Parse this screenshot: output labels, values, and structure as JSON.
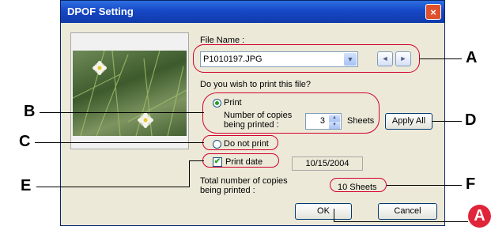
{
  "window": {
    "title": "DPOF Setting",
    "close_glyph": "×"
  },
  "labels": {
    "file_name": "File Name :",
    "question": "Do you wish to print this file?",
    "print": "Print",
    "copies_line1": "Number of copies",
    "copies_line2": "being printed :",
    "sheets": "Sheets",
    "do_not_print": "Do not print",
    "print_date": "Print date",
    "total_line1": "Total number of copies",
    "total_line2": "being printed :"
  },
  "file": {
    "name": "P1010197.JPG"
  },
  "copies": {
    "value": "3"
  },
  "date": {
    "value": "10/15/2004"
  },
  "total": {
    "value": "10  Sheets"
  },
  "buttons": {
    "apply_all": "Apply All",
    "ok": "OK",
    "cancel": "Cancel"
  },
  "icons": {
    "dropdown": "▼",
    "prev": "◄",
    "next": "►",
    "up": "▲",
    "down": "▼",
    "check": "✔"
  },
  "callouts": {
    "A": "A",
    "B": "B",
    "C": "C",
    "D": "D",
    "E": "E",
    "F": "F",
    "marker": "A"
  },
  "colors": {
    "highlight": "#d3002d",
    "title_bar": "#1748c7",
    "dialog_bg": "#ece9d8",
    "marker": "#e0253a"
  }
}
